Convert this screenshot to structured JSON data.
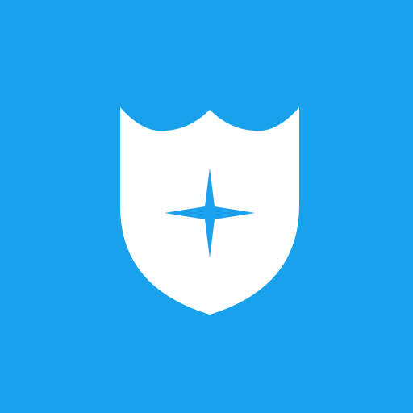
{
  "app_icon": {
    "icon": "shield-star-icon",
    "colors": {
      "background": "#1aa1eb",
      "shield": "#ffffff",
      "star": "#1aa1eb"
    }
  }
}
